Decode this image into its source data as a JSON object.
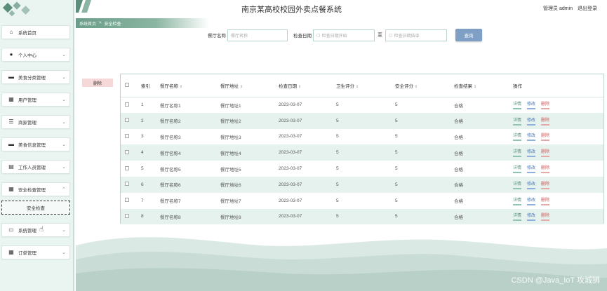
{
  "header": {
    "title": "南京某高校校园外卖点餐系统",
    "role": "管理员 admin",
    "logout": "退出登录"
  },
  "breadcrumb": {
    "home": "系统首页",
    "sep": ">",
    "current": "安全检查"
  },
  "sidebar": {
    "items": [
      {
        "label": "系统首页",
        "icon": "home-icon",
        "glyph": "⌂"
      },
      {
        "label": "个人中心",
        "icon": "user-icon",
        "glyph": "●"
      },
      {
        "label": "美食分类管理",
        "icon": "category-icon",
        "glyph": "▬"
      },
      {
        "label": "用户管理",
        "icon": "grid-icon",
        "glyph": "▦"
      },
      {
        "label": "商家管理",
        "icon": "settings-icon",
        "glyph": "☰"
      },
      {
        "label": "美食信息管理",
        "icon": "food-icon",
        "glyph": "▬"
      },
      {
        "label": "工作人员管理",
        "icon": "staff-icon",
        "glyph": "▤"
      },
      {
        "label": "安全检查管理",
        "icon": "shield-grid-icon",
        "glyph": "▦"
      },
      {
        "label": "系统管理",
        "icon": "briefcase-icon",
        "glyph": "▭"
      },
      {
        "label": "订单管理",
        "icon": "order-icon",
        "glyph": "▦"
      }
    ],
    "submenu_label": "安全检查"
  },
  "search": {
    "name_label": "餐厅名称",
    "name_placeholder": "餐厅名称",
    "date_label": "检查日期",
    "date_start_placeholder": "检查日期开始",
    "date_to": "至",
    "date_end_placeholder": "检查日期结束",
    "query_button": "查询"
  },
  "actions": {
    "delete_button": "删除"
  },
  "table": {
    "columns": [
      "索引",
      "餐厅名称",
      "餐厅地址",
      "检查日期",
      "卫生评分",
      "安全评分",
      "检查结果",
      "操作"
    ],
    "rows": [
      {
        "index": "1",
        "name": "餐厅名称1",
        "address": "餐厅地址1",
        "date": "2023-03-07",
        "hygiene": "5",
        "safety": "5",
        "result": "合格"
      },
      {
        "index": "2",
        "name": "餐厅名称2",
        "address": "餐厅地址2",
        "date": "2023-03-07",
        "hygiene": "5",
        "safety": "5",
        "result": "合格"
      },
      {
        "index": "3",
        "name": "餐厅名称3",
        "address": "餐厅地址3",
        "date": "2023-03-07",
        "hygiene": "5",
        "safety": "5",
        "result": "合格"
      },
      {
        "index": "4",
        "name": "餐厅名称4",
        "address": "餐厅地址4",
        "date": "2023-03-07",
        "hygiene": "5",
        "safety": "5",
        "result": "合格"
      },
      {
        "index": "5",
        "name": "餐厅名称5",
        "address": "餐厅地址5",
        "date": "2023-03-07",
        "hygiene": "5",
        "safety": "5",
        "result": "合格"
      },
      {
        "index": "6",
        "name": "餐厅名称6",
        "address": "餐厅地址6",
        "date": "2023-03-07",
        "hygiene": "5",
        "safety": "5",
        "result": "合格"
      },
      {
        "index": "7",
        "name": "餐厅名称7",
        "address": "餐厅地址7",
        "date": "2023-03-07",
        "hygiene": "5",
        "safety": "5",
        "result": "合格"
      },
      {
        "index": "8",
        "name": "餐厅名称8",
        "address": "餐厅地址8",
        "date": "2023-03-07",
        "hygiene": "5",
        "safety": "5",
        "result": "合格"
      }
    ],
    "row_actions": {
      "detail": "详情",
      "edit": "修改",
      "delete": "删除"
    }
  },
  "watermark": "CSDN @Java_IoT 攻城狮",
  "colors": {
    "sidebar_bg": "#eaf5f1",
    "accent": "#6a9d89",
    "row_stripe": "#e6f2ee",
    "query_button": "#7f9fc4",
    "delete": "#cc5a5a"
  }
}
